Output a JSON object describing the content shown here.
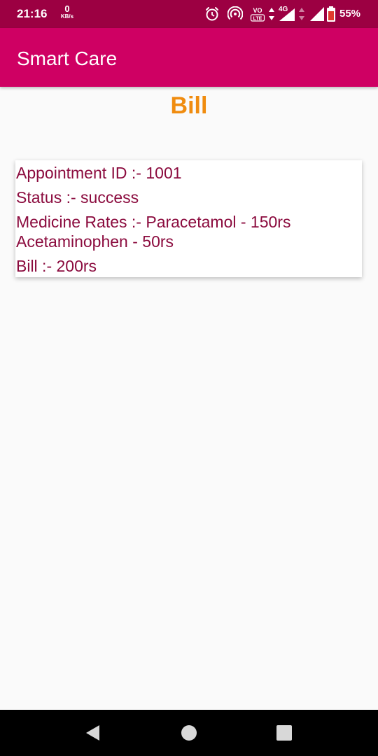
{
  "status_bar": {
    "time": "21:16",
    "net_speed_value": "0",
    "net_speed_unit": "KB/s",
    "icons": [
      "alarm-icon",
      "hotspot-icon",
      "volte-icon",
      "data-arrows-icon",
      "4g-signal-icon",
      "signal-icon",
      "battery-icon"
    ],
    "volte_label": "VO LTE",
    "network_type": "4G",
    "battery_percent": "55%"
  },
  "app_bar": {
    "title": "Smart Care",
    "color": "#cf0063"
  },
  "page": {
    "heading": "Bill",
    "heading_color": "#f08c0f"
  },
  "bill": {
    "appointment": "Appointment ID :- 1001",
    "status": "Status :- success",
    "medicine_rates_line1": "Medicine Rates :- Paracetamol - 150rs",
    "medicine_rates_line2": "Acetaminophen - 50rs",
    "total": "Bill :- 200rs",
    "text_color": "#8b0b3e"
  },
  "nav_bar": {
    "buttons": [
      "back-icon",
      "home-icon",
      "recents-icon"
    ]
  }
}
